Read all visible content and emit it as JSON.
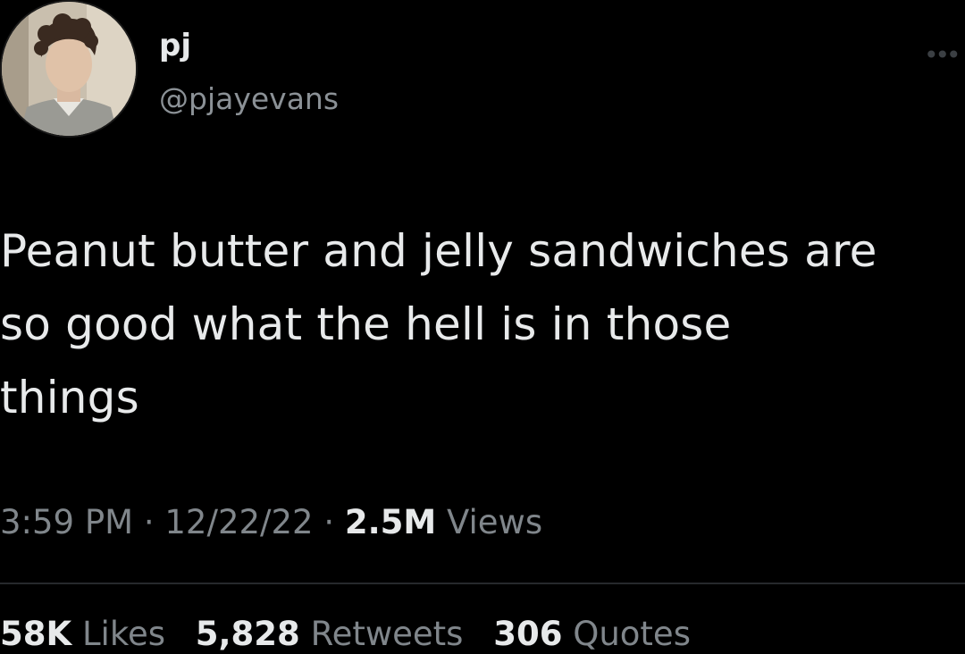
{
  "author": {
    "display_name": "pj",
    "handle": "@pjayevans",
    "avatar_icon": "profile-photo"
  },
  "more_icon": "more-options-icon",
  "tweet": {
    "lines": [
      "Peanut butter and jelly sandwiches are",
      "so good what the hell is in those",
      "things"
    ],
    "time": "3:59 PM",
    "separator": "·",
    "date": "12/22/22",
    "views_count": "2.5M",
    "views_label": "Views"
  },
  "stats": {
    "likes_count": "58K",
    "likes_label": "Likes",
    "retweets_count": "5,828",
    "retweets_label": "Retweets",
    "quotes_count": "306",
    "quotes_label": "Quotes"
  },
  "colors": {
    "background": "#000000",
    "primary_text": "#e7e9ea",
    "secondary_text": "#80868b",
    "divider": "#26292c"
  }
}
